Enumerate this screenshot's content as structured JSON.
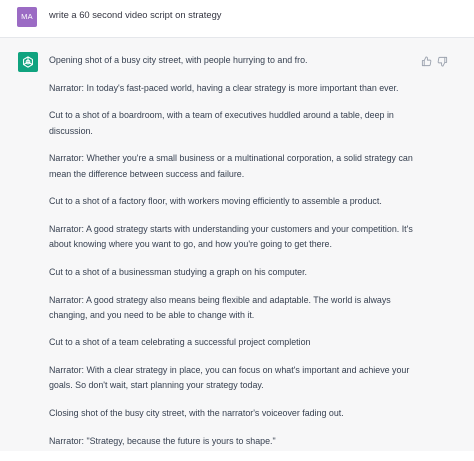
{
  "user": {
    "avatar_initials": "MA",
    "avatar_color": "#9b6bc4",
    "prompt": "write a 60 second video script on strategy"
  },
  "assistant": {
    "avatar_icon": "openai-logo-icon",
    "avatar_color": "#10a37f",
    "feedback_icons": [
      "thumbs-up-icon",
      "thumbs-down-icon"
    ],
    "paragraphs": [
      "Opening shot of a busy city street, with people hurrying to and fro.",
      "Narrator: In today's fast-paced world, having a clear strategy is more important than ever.",
      "Cut to a shot of a boardroom, with a team of executives huddled around a table, deep in discussion.",
      "Narrator: Whether you're a small business or a multinational corporation, a solid strategy can mean the difference between success and failure.",
      "Cut to a shot of a factory floor, with workers moving efficiently to assemble a product.",
      "Narrator: A good strategy starts with understanding your customers and your competition. It's about knowing where you want to go, and how you're going to get there.",
      "Cut to a shot of a businessman studying a graph on his computer.",
      "Narrator: A good strategy also means being flexible and adaptable. The world is always changing, and you need to be able to change with it.",
      "Cut to a shot of a team celebrating a successful project completion",
      "Narrator: With a clear strategy in place, you can focus on what's important and achieve your goals. So don't wait, start planning your strategy today.",
      "Closing shot of the busy city street, with the narrator's voiceover fading out.",
      "Narrator: \"Strategy, because the future is yours to shape.\""
    ]
  }
}
